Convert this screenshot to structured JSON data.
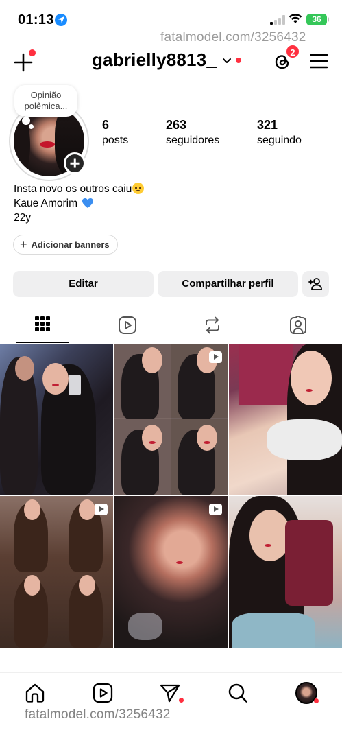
{
  "status_bar": {
    "time": "01:13",
    "battery": "36",
    "icons": [
      "location-arrow-icon",
      "cellular-signal-icon",
      "wifi-icon",
      "battery-charging-icon"
    ]
  },
  "watermark": {
    "top": "fatalmodel.com/3256432",
    "bottom": "fatalmodel.com/3256432"
  },
  "header": {
    "username": "gabrielly8813_",
    "threads_badge_count": "2",
    "icons": [
      "plus-icon",
      "chevron-down-icon",
      "threads-icon",
      "menu-icon"
    ]
  },
  "profile": {
    "note_line1": "Opinião",
    "note_line2": "polêmica...",
    "stats": {
      "posts_count": "6",
      "posts_label": "posts",
      "followers_count": "263",
      "followers_label": "seguidores",
      "following_count": "321",
      "following_label": "seguindo"
    },
    "bio_line1": "Insta novo os outros caiu",
    "bio_line2": "Kaue Amorim",
    "bio_line3": "22y",
    "add_banners": "Adicionar banners"
  },
  "actions": {
    "edit": "Editar",
    "share": "Compartilhar perfil"
  },
  "tabs": [
    {
      "name": "grid",
      "icon": "grid-icon",
      "active": true
    },
    {
      "name": "reels",
      "icon": "reels-icon",
      "active": false
    },
    {
      "name": "reposts",
      "icon": "repost-icon",
      "active": false
    },
    {
      "name": "tagged",
      "icon": "tagged-user-icon",
      "active": false
    }
  ],
  "posts": [
    {
      "type": "photo"
    },
    {
      "type": "reel"
    },
    {
      "type": "photo"
    },
    {
      "type": "reel"
    },
    {
      "type": "reel"
    },
    {
      "type": "photo"
    }
  ],
  "bottom_nav": [
    "home-icon",
    "reels-icon",
    "direct-message-icon",
    "search-icon",
    "profile-avatar"
  ],
  "colors": {
    "notification_red": "#ff3040",
    "button_bg": "#efeff0",
    "battery_green": "#35c759",
    "location_blue": "#1a8cff",
    "heart_blue": "#3b8ef0"
  }
}
